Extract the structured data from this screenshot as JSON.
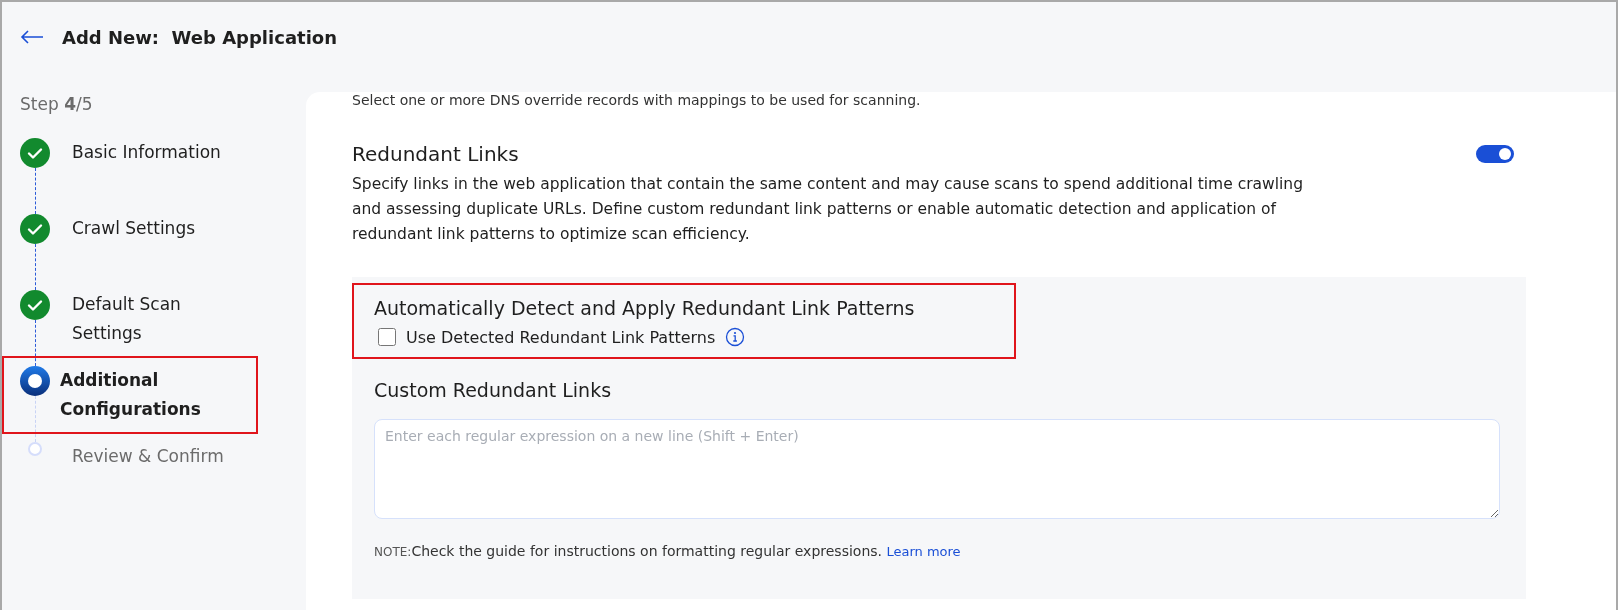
{
  "header": {
    "title": "Add New:  Web Application"
  },
  "stepper": {
    "counter": "Step **4**/5",
    "steps": [
      {
        "label": "Basic Information",
        "completed": true,
        "selected": false,
        "highlighted": false
      },
      {
        "label": "Crawl Settings",
        "completed": true,
        "selected": false,
        "highlighted": false
      },
      {
        "label": "Default Scan Settings",
        "completed": true,
        "selected": false,
        "highlighted": false
      },
      {
        "label": "Additional Configurations",
        "completed": false,
        "selected": true,
        "highlighted": true
      },
      {
        "label": "Review & Confirm",
        "completed": false,
        "selected": false,
        "highlighted": false
      }
    ]
  },
  "previous_section_text": "Select one or more DNS override records with mappings to be used for scanning.",
  "redundant_links": {
    "title": "Redundant Links",
    "on": true,
    "description": "Specify links in the web application that contain the same content and may cause scans to spend additional time crawling and assessing duplicate URLs. Define custom redundant link patterns or enable automatic detection and application of redundant link patterns to optimize scan efficiency.",
    "auto_detect": {
      "title": "Automatically Detect and Apply Redundant Link Patterns",
      "highlighted": true,
      "checkbox_label": "Use Detected Redundant Link Patterns",
      "checked": false
    },
    "custom": {
      "title": "Custom Redundant Links",
      "placeholder": "Enter each regular expression on a new line (Shift + Enter)"
    },
    "note": {
      "label": "NOTE:",
      "text": "Check the guide for instructions on formatting regular expressions.",
      "link": "Learn more"
    }
  }
}
